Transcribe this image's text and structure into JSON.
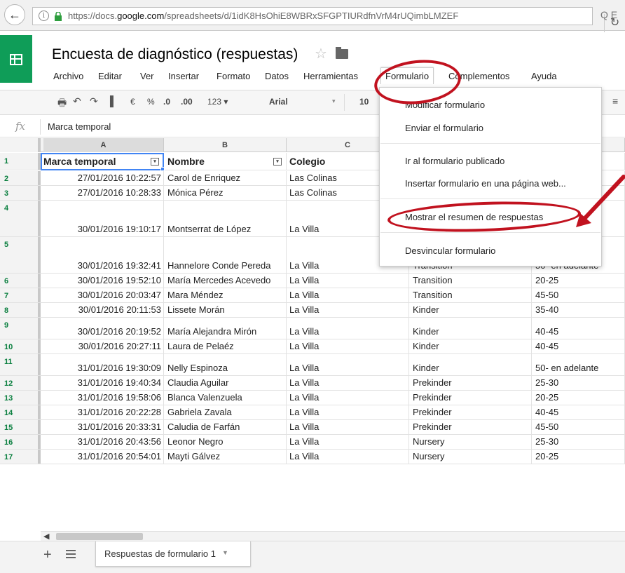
{
  "browser": {
    "url_prefix": "https://docs.",
    "url_domain": "google.com",
    "url_path": "/spreadsheets/d/1idK8HsOhiE8WBRxSFGPTIURdfnVrM4rUQimbLMZEF",
    "back_icon": "back-arrow-icon",
    "reload_icon": "reload-icon",
    "search_icon": "search-icon",
    "search_glyph": "Q",
    "search_trail": "E"
  },
  "doc": {
    "title": "Encuesta de diagnóstico (respuestas)",
    "star": "☆"
  },
  "menu": [
    "Archivo",
    "Editar",
    "Ver",
    "Insertar",
    "Formato",
    "Datos",
    "Herramientas",
    "Formulario",
    "Complementos",
    "Ayuda"
  ],
  "toolbar": {
    "currency": "€",
    "percent": "%",
    "dec_less": ".0",
    "dec_more": ".00",
    "number_format": "123",
    "font": "Arial",
    "font_size": "10"
  },
  "formula_bar": {
    "fx": "fx",
    "value": "Marca temporal"
  },
  "columns": [
    "A",
    "B",
    "C",
    "D",
    "E"
  ],
  "header_row": {
    "number": "1",
    "cells": [
      "Marca temporal",
      "Nombre",
      "Colegio",
      "",
      ""
    ]
  },
  "rows": [
    {
      "n": "2",
      "ts": "27/01/2016 10:22:57",
      "nombre": "Carol de Enriquez",
      "colegio": "Las Colinas",
      "grado": "",
      "edad": ""
    },
    {
      "n": "3",
      "ts": "27/01/2016 10:28:33",
      "nombre": "Mónica Pérez",
      "colegio": "Las Colinas",
      "grado": "",
      "edad": ""
    },
    {
      "n": "4",
      "ts": "30/01/2016 19:10:17",
      "nombre": "Montserrat de López",
      "colegio": "La Villa",
      "grado": "",
      "edad": ""
    },
    {
      "n": "5",
      "ts": "30/01/2016 19:32:41",
      "nombre": "Hannelore Conde Pereda",
      "colegio": "La Villa",
      "grado": "Transition",
      "edad": "50- en adelante"
    },
    {
      "n": "6",
      "ts": "30/01/2016 19:52:10",
      "nombre": "María Mercedes Acevedo",
      "colegio": "La Villa",
      "grado": "Transition",
      "edad": "20-25"
    },
    {
      "n": "7",
      "ts": "30/01/2016 20:03:47",
      "nombre": "Mara Méndez",
      "colegio": "La Villa",
      "grado": "Transition",
      "edad": "45-50"
    },
    {
      "n": "8",
      "ts": "30/01/2016 20:11:53",
      "nombre": "Lissete Morán",
      "colegio": "La Villa",
      "grado": "Kinder",
      "edad": "35-40"
    },
    {
      "n": "9",
      "ts": "30/01/2016 20:19:52",
      "nombre": "María Alejandra Mirón",
      "colegio": "La Villa",
      "grado": "Kinder",
      "edad": "40-45"
    },
    {
      "n": "10",
      "ts": "30/01/2016 20:27:11",
      "nombre": "Laura de Pelaéz",
      "colegio": "La Villa",
      "grado": "Kinder",
      "edad": "40-45"
    },
    {
      "n": "11",
      "ts": "31/01/2016 19:30:09",
      "nombre": "Nelly Espinoza",
      "colegio": "La Villa",
      "grado": "Kinder",
      "edad": "50- en adelante"
    },
    {
      "n": "12",
      "ts": "31/01/2016 19:40:34",
      "nombre": "Claudia Aguilar",
      "colegio": "La Villa",
      "grado": "Prekinder",
      "edad": "25-30"
    },
    {
      "n": "13",
      "ts": "31/01/2016 19:58:06",
      "nombre": "Blanca Valenzuela",
      "colegio": "La Villa",
      "grado": "Prekinder",
      "edad": "20-25"
    },
    {
      "n": "14",
      "ts": "31/01/2016 20:22:28",
      "nombre": "Gabriela Zavala",
      "colegio": "La Villa",
      "grado": "Prekinder",
      "edad": "40-45"
    },
    {
      "n": "15",
      "ts": "31/01/2016 20:33:31",
      "nombre": "Caludia de Farfán",
      "colegio": "La Villa",
      "grado": "Prekinder",
      "edad": "45-50"
    },
    {
      "n": "16",
      "ts": "31/01/2016 20:43:56",
      "nombre": "Leonor Negro",
      "colegio": "La Villa",
      "grado": "Nursery",
      "edad": "25-30"
    },
    {
      "n": "17",
      "ts": "31/01/2016 20:54:01",
      "nombre": "Mayti Gálvez",
      "colegio": "La Villa",
      "grado": "Nursery",
      "edad": "20-25"
    }
  ],
  "dropdown": {
    "items": [
      "Modificar formulario",
      "Enviar el formulario",
      "Ir al formulario publicado",
      "Insertar formulario en una página web...",
      "Mostrar el resumen de respuestas",
      "Desvincular formulario"
    ]
  },
  "sheet_tab": {
    "label": "Respuestas de formulario 1",
    "add": "+"
  },
  "colors": {
    "sheets_green": "#0f9d58",
    "annotation_red": "#c1121f",
    "selection_blue": "#4285f4",
    "row_number_green": "#0a7f3f"
  }
}
